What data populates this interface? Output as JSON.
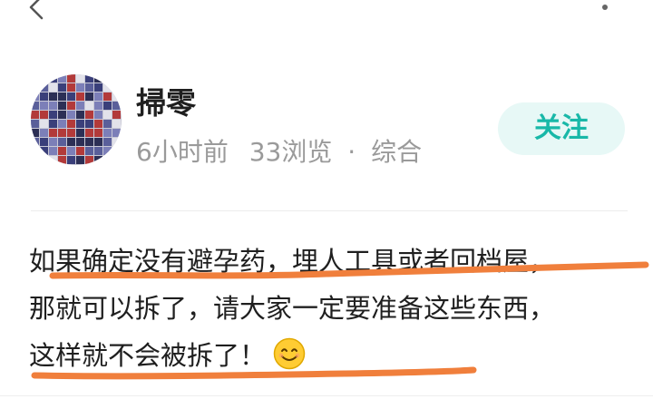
{
  "post": {
    "author": {
      "name": "掃零"
    },
    "meta": {
      "time": "6小时前",
      "views": "33浏览",
      "separator": "·",
      "category": "综合"
    },
    "follow_label": "关注",
    "body_lines": [
      "如果确定没有避孕药，埋人工具或者回档屋，",
      "那就可以拆了，请大家一定要准备这些东西，",
      "这样就不会被拆了！"
    ],
    "emoji": "smiling-face"
  },
  "colors": {
    "accent": "#19b8a8",
    "follow_bg": "#e7f8f6",
    "annotation_stroke": "#f07f3c",
    "meta_text": "#9a9a9a"
  },
  "icons": {
    "back": "back-arrow-icon",
    "more": "more-dots-icon"
  }
}
